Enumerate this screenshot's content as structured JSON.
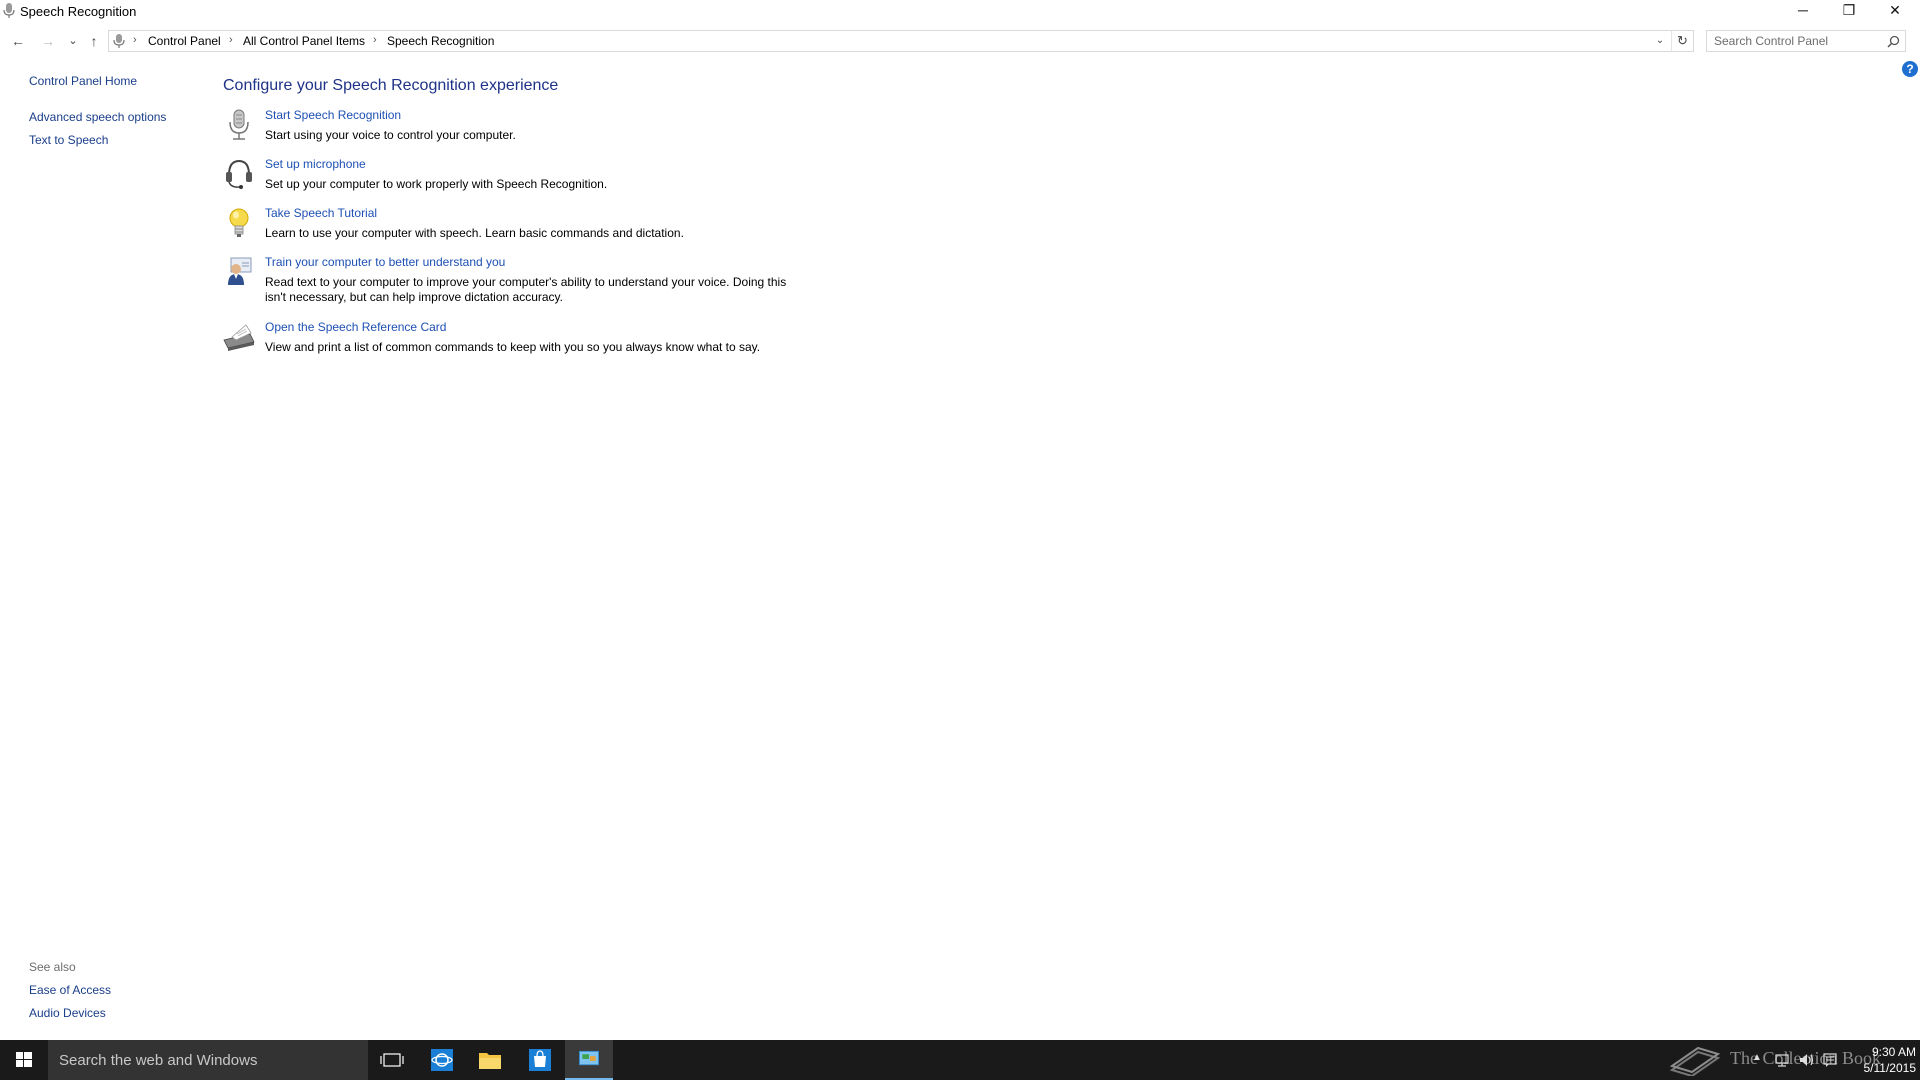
{
  "window": {
    "title": "Speech Recognition",
    "controls": {
      "minimize": "─",
      "maximize": "❐",
      "close": "✕"
    }
  },
  "nav": {
    "back": "←",
    "forward": "→",
    "recent": "⌄",
    "up": "↑",
    "breadcrumbs": [
      "Control Panel",
      "All Control Panel Items",
      "Speech Recognition"
    ],
    "separator": "›",
    "dropdown": "⌄",
    "refresh": "↻",
    "search_placeholder": "Search Control Panel"
  },
  "help_label": "?",
  "left_pane": {
    "home": "Control Panel Home",
    "links": [
      "Advanced speech options",
      "Text to Speech"
    ],
    "see_also_label": "See also",
    "see_also": [
      "Ease of Access",
      "Audio Devices"
    ]
  },
  "main": {
    "heading": "Configure your Speech Recognition experience",
    "tasks": [
      {
        "icon": "microphone-icon",
        "link": "Start Speech Recognition",
        "desc": "Start using your voice to control your computer."
      },
      {
        "icon": "headset-icon",
        "link": "Set up microphone",
        "desc": "Set up your computer to work properly with Speech Recognition."
      },
      {
        "icon": "lightbulb-icon",
        "link": "Take Speech Tutorial",
        "desc": "Learn to use your computer with speech.  Learn basic commands and dictation."
      },
      {
        "icon": "user-training-icon",
        "link": "Train your computer to better understand you",
        "desc": "Read text to your computer to improve your computer's ability to understand your voice.  Doing this isn't necessary, but can help improve dictation accuracy."
      },
      {
        "icon": "printer-icon",
        "link": "Open the Speech Reference Card",
        "desc": "View and print a list of common commands to keep with you so you always know what to say."
      }
    ]
  },
  "taskbar": {
    "search_placeholder": "Search the web and Windows",
    "apps": [
      "task-view-icon",
      "internet-explorer-icon",
      "file-explorer-icon",
      "store-icon",
      "control-panel-icon"
    ],
    "watermark": "The Collection Book",
    "clock_time": "9:30 AM",
    "clock_date": "5/11/2015",
    "tray_up": "▲"
  },
  "colors": {
    "link": "#1e50b4",
    "heading": "#1e3287",
    "taskbar": "#1a1a1a",
    "accent": "#1e6fd0"
  }
}
